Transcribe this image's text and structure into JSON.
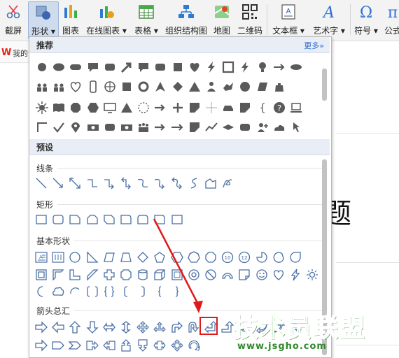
{
  "ribbon": {
    "screenshot": "截屏",
    "shape": "形状",
    "chart": "图表",
    "online_chart": "在线图表",
    "table": "表格",
    "org_chart": "组织结构图",
    "map": "地图",
    "qrcode": "二维码",
    "textbox": "文本框",
    "wordart": "艺术字",
    "symbol": "符号",
    "formula": "公式"
  },
  "subbar": {
    "text": "我的"
  },
  "document": {
    "title_fragment": "题"
  },
  "panel": {
    "recommended": "推荐",
    "more": "更多»",
    "presets": "预设",
    "lines": "线条",
    "rectangles": "矩形",
    "basic_shapes": "基本形状",
    "block_arrows": "箭头总汇"
  },
  "watermark": {
    "title": "技术员联盟",
    "url": "www.jsgho.com"
  },
  "colors": {
    "shape_stroke": "#4a6fa5",
    "rec_gray": "#5a5a5a",
    "highlight": "#e01919",
    "arrow": "#e01919"
  }
}
